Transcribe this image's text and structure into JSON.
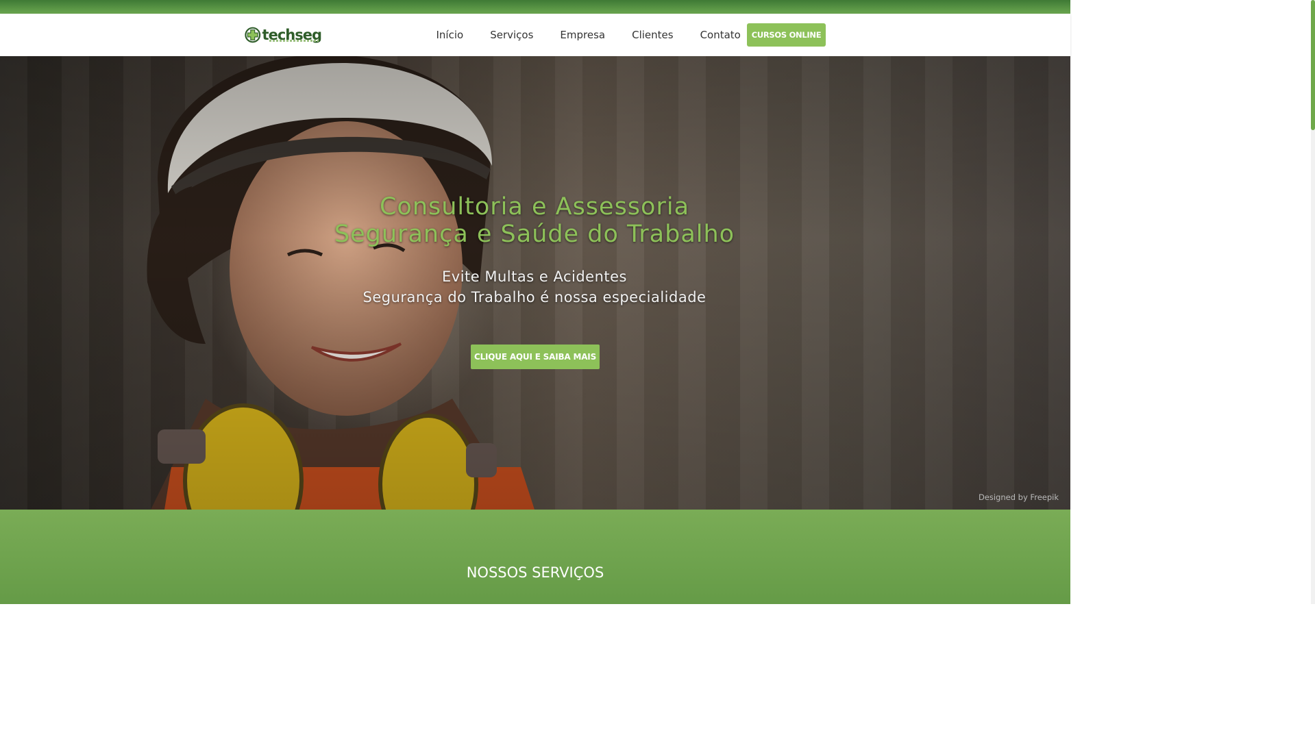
{
  "brand": {
    "name": "techseg",
    "tagline": "CONSULTORIA EM SEGURANÇA DO TRABALHO",
    "primary_color": "#8dc159",
    "dark_color": "#2f5d2a"
  },
  "nav": {
    "items": [
      "Início",
      "Serviços",
      "Empresa",
      "Clientes",
      "Contato"
    ],
    "cta_label": "CURSOS ONLINE"
  },
  "hero": {
    "title_line1": "Consultoria e Assessoria",
    "title_line2": "Segurança e Saúde do Trabalho",
    "sub_line1": "Evite Multas e Acidentes",
    "sub_line2": "Segurança do Trabalho é nossa especialidade",
    "cta_label": "CLIQUE AQUI E SAIBA MAIS",
    "credit": "Designed by Freepik"
  },
  "services": {
    "title": "NOSSOS SERVIÇOS"
  }
}
